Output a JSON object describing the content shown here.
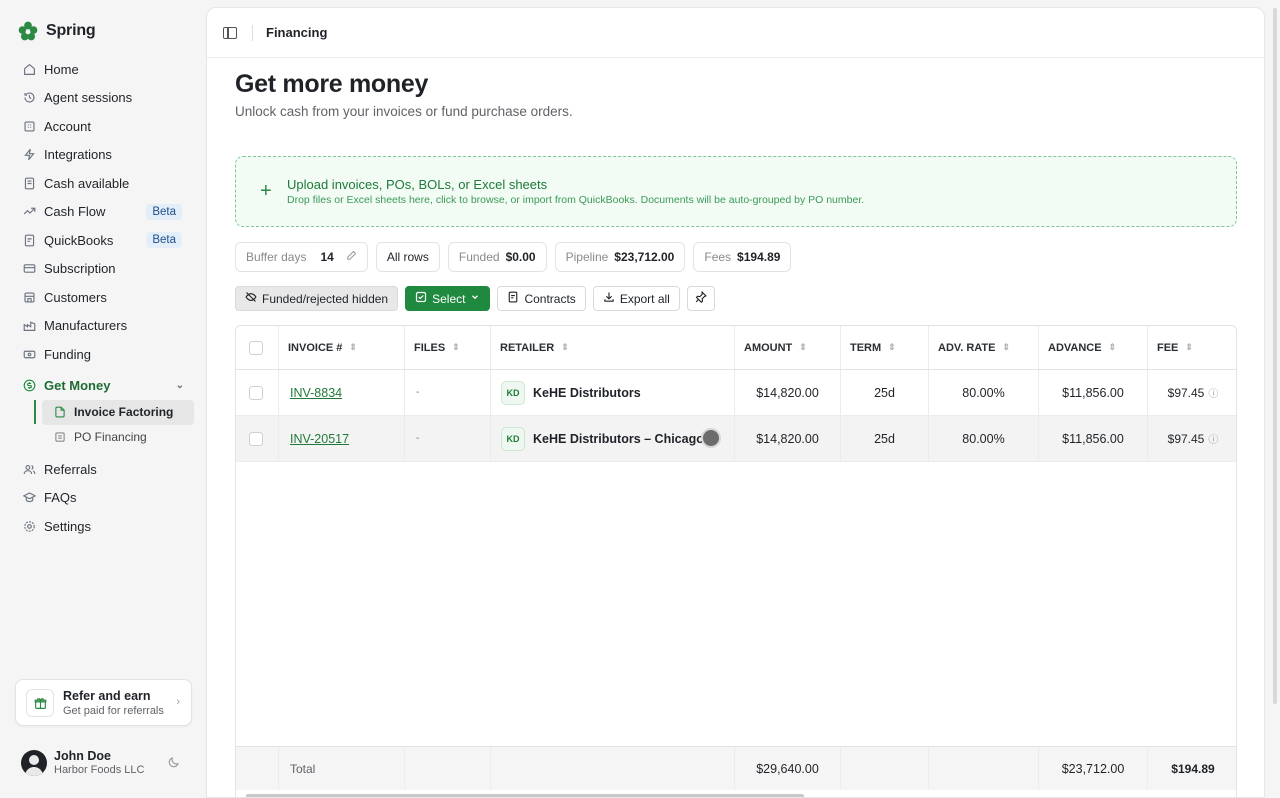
{
  "brand": {
    "name": "Spring"
  },
  "sidebar": {
    "items": [
      {
        "label": "Home"
      },
      {
        "label": "Agent sessions"
      },
      {
        "label": "Account"
      },
      {
        "label": "Integrations"
      },
      {
        "label": "Cash available"
      },
      {
        "label": "Cash Flow",
        "badge": "Beta"
      },
      {
        "label": "QuickBooks",
        "badge": "Beta"
      },
      {
        "label": "Subscription"
      },
      {
        "label": "Customers"
      },
      {
        "label": "Manufacturers"
      },
      {
        "label": "Funding"
      }
    ],
    "group": {
      "label": "Get Money",
      "children": [
        {
          "label": "Invoice Factoring"
        },
        {
          "label": "PO Financing"
        }
      ]
    },
    "bottom_items": [
      {
        "label": "Referrals"
      },
      {
        "label": "FAQs"
      },
      {
        "label": "Settings"
      }
    ],
    "refer": {
      "title": "Refer and earn",
      "subtitle": "Get paid for referrals"
    },
    "user": {
      "name": "John Doe",
      "org": "Harbor Foods LLC"
    }
  },
  "header": {
    "breadcrumb": "Financing"
  },
  "page": {
    "title": "Get more money",
    "subtitle": "Unlock cash from your invoices or fund purchase orders."
  },
  "upload": {
    "title": "Upload invoices, POs, BOLs, or Excel sheets",
    "hint": "Drop files or Excel sheets here, click to browse, or import from QuickBooks. Documents will be auto-grouped by PO number."
  },
  "chips": {
    "buffer_label": "Buffer days",
    "buffer_value": "14",
    "all_rows": "All rows",
    "funded_label": "Funded",
    "funded_value": "$0.00",
    "pipeline_label": "Pipeline",
    "pipeline_value": "$23,712.00",
    "fees_label": "Fees",
    "fees_value": "$194.89"
  },
  "actions": {
    "funded_hidden": "Funded/rejected hidden",
    "select": "Select",
    "contracts": "Contracts",
    "export_all": "Export all"
  },
  "table": {
    "headers": [
      "INVOICE #",
      "FILES",
      "RETAILER",
      "AMOUNT",
      "TERM",
      "ADV. RATE",
      "ADVANCE",
      "FEE"
    ],
    "rows": [
      {
        "invoice": "INV-8834",
        "files": "-",
        "initials": "KD",
        "retailer": "KeHE Distributors",
        "amount": "$14,820.00",
        "term": "25d",
        "rate": "80.00%",
        "advance": "$11,856.00",
        "fee": "$97.45"
      },
      {
        "invoice": "INV-20517",
        "files": "-",
        "initials": "KD",
        "retailer": "KeHE Distributors – Chicago",
        "amount": "$14,820.00",
        "term": "25d",
        "rate": "80.00%",
        "advance": "$11,856.00",
        "fee": "$97.45"
      }
    ],
    "total": {
      "label": "Total",
      "amount": "$29,640.00",
      "advance": "$23,712.00",
      "fee": "$194.89"
    }
  },
  "colors": {
    "accent": "#1f8a3f",
    "beta_badge_bg": "#e4eef9"
  }
}
